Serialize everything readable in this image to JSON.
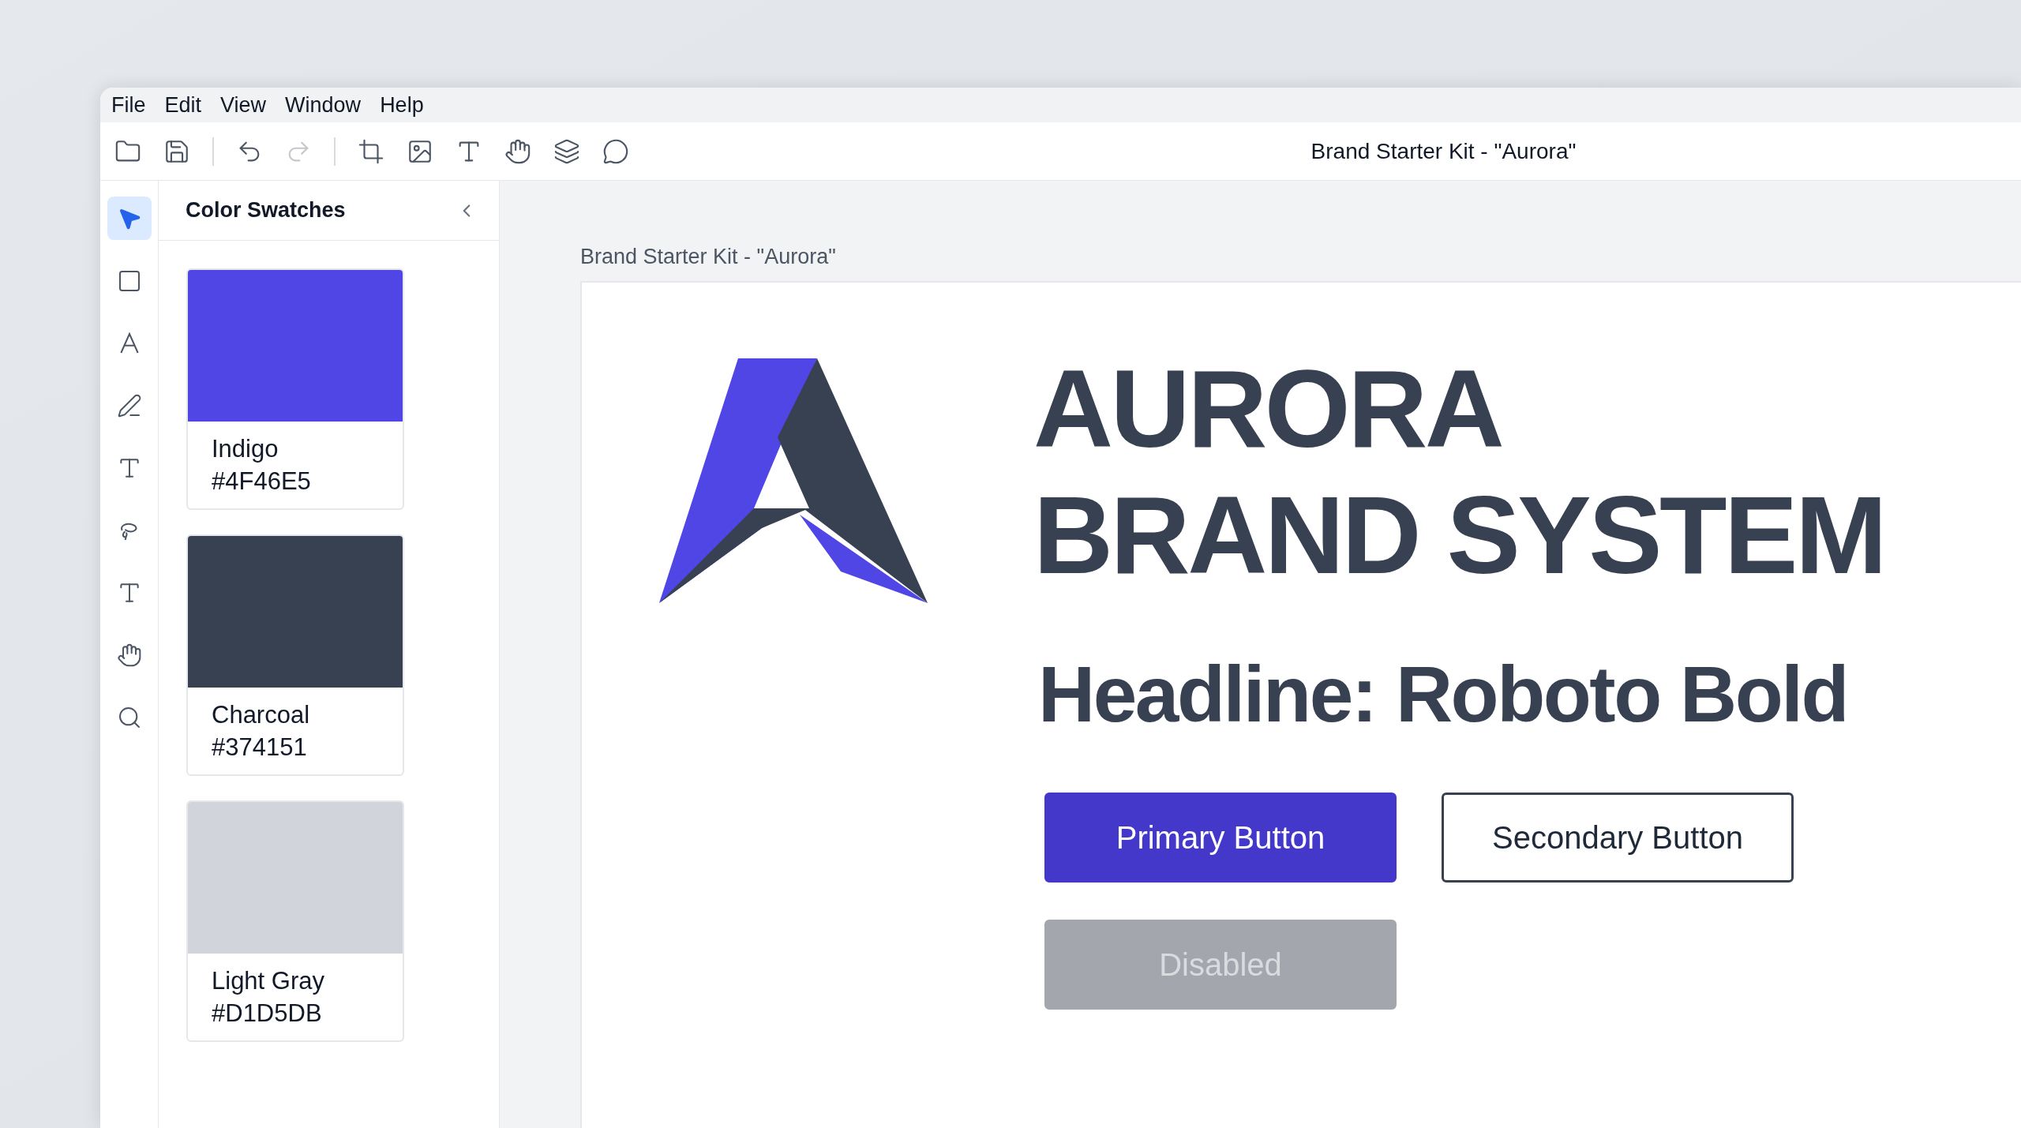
{
  "menu": [
    "File",
    "Edit",
    "View",
    "Window",
    "Help"
  ],
  "toolbar": [
    {
      "kind": "open",
      "disabled": false
    },
    {
      "kind": "save",
      "disabled": false
    },
    {
      "kind": "divider"
    },
    {
      "kind": "undo",
      "disabled": false
    },
    {
      "kind": "redo",
      "disabled": true
    },
    {
      "kind": "divider"
    },
    {
      "kind": "crop",
      "disabled": false
    },
    {
      "kind": "image",
      "disabled": false
    },
    {
      "kind": "text",
      "disabled": false
    },
    {
      "kind": "hand",
      "disabled": false
    },
    {
      "kind": "layers",
      "disabled": false
    },
    {
      "kind": "comment",
      "disabled": false
    }
  ],
  "window": {
    "title": "Brand Starter Kit - \"Aurora\""
  },
  "tools": [
    {
      "kind": "pointer",
      "selected": true
    },
    {
      "kind": "rectangle",
      "selected": false
    },
    {
      "kind": "letter",
      "selected": false
    },
    {
      "kind": "line",
      "selected": false
    },
    {
      "kind": "text",
      "selected": false
    },
    {
      "kind": "lasso",
      "selected": false
    },
    {
      "kind": "text",
      "selected": false
    },
    {
      "kind": "hand",
      "selected": false
    },
    {
      "kind": "zoom",
      "selected": false
    }
  ],
  "panel": {
    "title": "Color Swatches",
    "swatches": [
      {
        "name": "Indigo",
        "hex": "#4F46E5",
        "color": "#4f46e5"
      },
      {
        "name": "Charcoal",
        "hex": "#374151",
        "color": "#374151"
      },
      {
        "name": "Light Gray",
        "hex": "#D1D5DB",
        "color": "#d1d5db"
      }
    ]
  },
  "canvas": {
    "label": "Brand Starter Kit - \"Aurora\"",
    "title_lines": [
      "AURORA",
      "BRAND SYSTEM"
    ],
    "headline": "Headline: Roboto Bold",
    "buttons": [
      {
        "label": "Primary Button",
        "kind": "primary"
      },
      {
        "label": "Secondary Button",
        "kind": "secondary"
      },
      {
        "label": "Disabled",
        "kind": "disabled"
      }
    ]
  }
}
